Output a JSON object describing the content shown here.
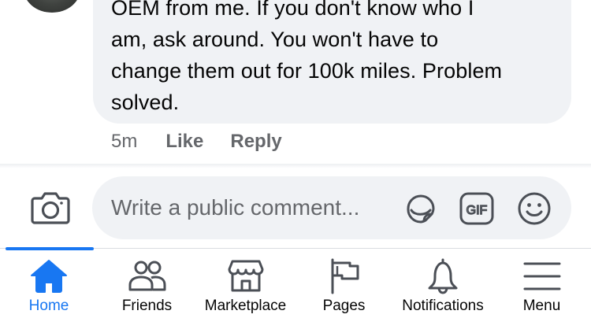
{
  "comment": {
    "text": "OEM from me. If you don't know who I\nam, ask around. You won't have to\nchange them out for 100k miles. Problem\nsolved.",
    "time": "5m",
    "like_label": "Like",
    "reply_label": "Reply"
  },
  "composer": {
    "placeholder": "Write a public comment..."
  },
  "tabbar": {
    "active_color": "#1877f2",
    "tabs": [
      {
        "label": "Home",
        "icon": "home-icon",
        "active": true
      },
      {
        "label": "Friends",
        "icon": "friends-icon",
        "active": false
      },
      {
        "label": "Marketplace",
        "icon": "marketplace-icon",
        "active": false
      },
      {
        "label": "Pages",
        "icon": "pages-flag-icon",
        "active": false
      },
      {
        "label": "Notifications",
        "icon": "bell-icon",
        "active": false
      },
      {
        "label": "Menu",
        "icon": "menu-icon",
        "active": false
      }
    ]
  }
}
